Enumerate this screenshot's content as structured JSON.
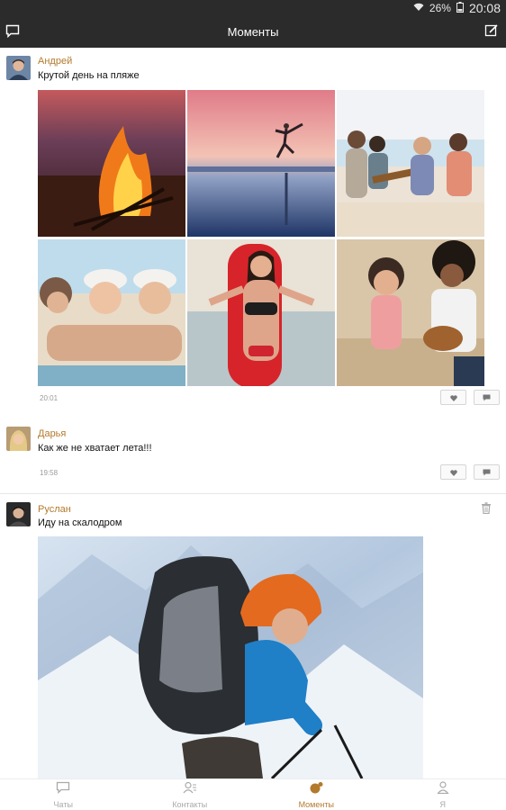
{
  "status_bar": {
    "battery": "26%",
    "time": "20:08",
    "icons": [
      "wifi-icon",
      "battery-icon"
    ]
  },
  "header": {
    "title": "Моменты",
    "left_icon": "message-icon",
    "right_icon": "compose-icon"
  },
  "posts": [
    {
      "author": "Андрей",
      "text": "Крутой день на пляже",
      "time": "20:01",
      "photos": [
        "campfire-photo",
        "beach-runner-photo",
        "friends-guitar-photo",
        "girls-beach-photo",
        "bikini-surfboard-photo",
        "couple-guitar-photo"
      ]
    },
    {
      "author": "Дарья",
      "text": "Как же не хватает лета!!!",
      "time": "19:58"
    },
    {
      "author": "Руслан",
      "text": "Иду на скалодром",
      "photos": [
        "climber-photo"
      ]
    }
  ],
  "bottom_nav": [
    {
      "label": "Чаты",
      "icon": "chat-icon"
    },
    {
      "label": "Контакты",
      "icon": "contacts-icon"
    },
    {
      "label": "Моменты",
      "icon": "moments-icon",
      "active": true
    },
    {
      "label": "Я",
      "icon": "profile-icon"
    }
  ],
  "colors": {
    "accent": "#b37a2c",
    "bar": "#2b2b2b"
  }
}
